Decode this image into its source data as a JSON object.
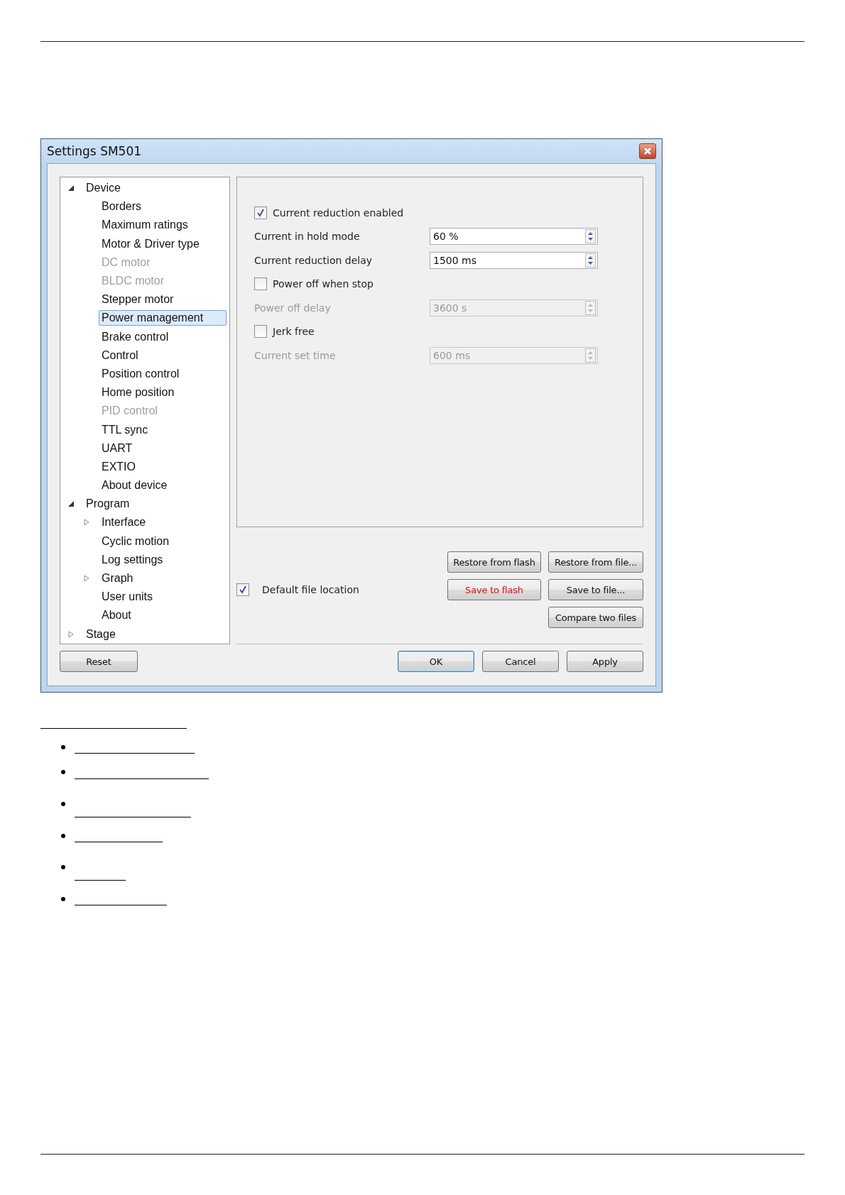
{
  "window": {
    "title": "Settings SM501"
  },
  "tree": [
    {
      "label": "Device",
      "expanded": true,
      "disabled": false,
      "selected": false,
      "children": [
        {
          "label": "Borders",
          "disabled": false,
          "selected": false
        },
        {
          "label": "Maximum ratings",
          "disabled": false,
          "selected": false
        },
        {
          "label": "Motor & Driver type",
          "disabled": false,
          "selected": false
        },
        {
          "label": "DC motor",
          "disabled": true,
          "selected": false
        },
        {
          "label": "BLDC motor",
          "disabled": true,
          "selected": false
        },
        {
          "label": "Stepper motor",
          "disabled": false,
          "selected": false
        },
        {
          "label": "Power management",
          "disabled": false,
          "selected": true
        },
        {
          "label": "Brake control",
          "disabled": false,
          "selected": false
        },
        {
          "label": "Control",
          "disabled": false,
          "selected": false
        },
        {
          "label": "Position control",
          "disabled": false,
          "selected": false
        },
        {
          "label": "Home position",
          "disabled": false,
          "selected": false
        },
        {
          "label": "PID control",
          "disabled": true,
          "selected": false
        },
        {
          "label": "TTL sync",
          "disabled": false,
          "selected": false
        },
        {
          "label": "UART",
          "disabled": false,
          "selected": false
        },
        {
          "label": "EXTIO",
          "disabled": false,
          "selected": false
        },
        {
          "label": "About device",
          "disabled": false,
          "selected": false
        }
      ]
    },
    {
      "label": "Program",
      "expanded": true,
      "disabled": false,
      "selected": false,
      "children": [
        {
          "label": "Interface",
          "expanded": false,
          "disabled": false,
          "selected": false
        },
        {
          "label": "Cyclic motion",
          "disabled": false,
          "selected": false
        },
        {
          "label": "Log settings",
          "disabled": false,
          "selected": false
        },
        {
          "label": "Graph",
          "expanded": false,
          "disabled": false,
          "selected": false
        },
        {
          "label": "User units",
          "disabled": false,
          "selected": false
        },
        {
          "label": "About",
          "disabled": false,
          "selected": false
        }
      ]
    },
    {
      "label": "Stage",
      "expanded": false,
      "disabled": false,
      "selected": false
    }
  ],
  "settings": [
    {
      "kind": "checkbox",
      "label": "Current reduction enabled",
      "checked": true
    },
    {
      "kind": "spin",
      "label": "Current in hold mode",
      "value": "60 %",
      "disabled": false
    },
    {
      "kind": "spin",
      "label": "Current reduction delay",
      "value": "1500 ms",
      "disabled": false
    },
    {
      "kind": "checkbox",
      "label": "Power off when stop",
      "checked": false
    },
    {
      "kind": "spin",
      "label": "Power off delay",
      "value": "3600 s",
      "disabled": true
    },
    {
      "kind": "checkbox",
      "label": "Jerk free",
      "checked": false
    },
    {
      "kind": "spin",
      "label": "Current set time",
      "value": "600 ms",
      "disabled": true
    }
  ],
  "default_file_location": {
    "label": "Default file location",
    "checked": true
  },
  "file_buttons": [
    {
      "label": "Restore from flash",
      "alert": false
    },
    {
      "label": "Restore from file...",
      "alert": false
    },
    {
      "label": "Save to flash",
      "alert": true
    },
    {
      "label": "Save to file...",
      "alert": false
    },
    {
      "label": "Compare two files",
      "alert": false
    }
  ],
  "reset_button": "Reset",
  "dialog_buttons": [
    {
      "label": "OK",
      "default": true
    },
    {
      "label": "Cancel",
      "default": false
    },
    {
      "label": "Apply",
      "default": false
    }
  ]
}
